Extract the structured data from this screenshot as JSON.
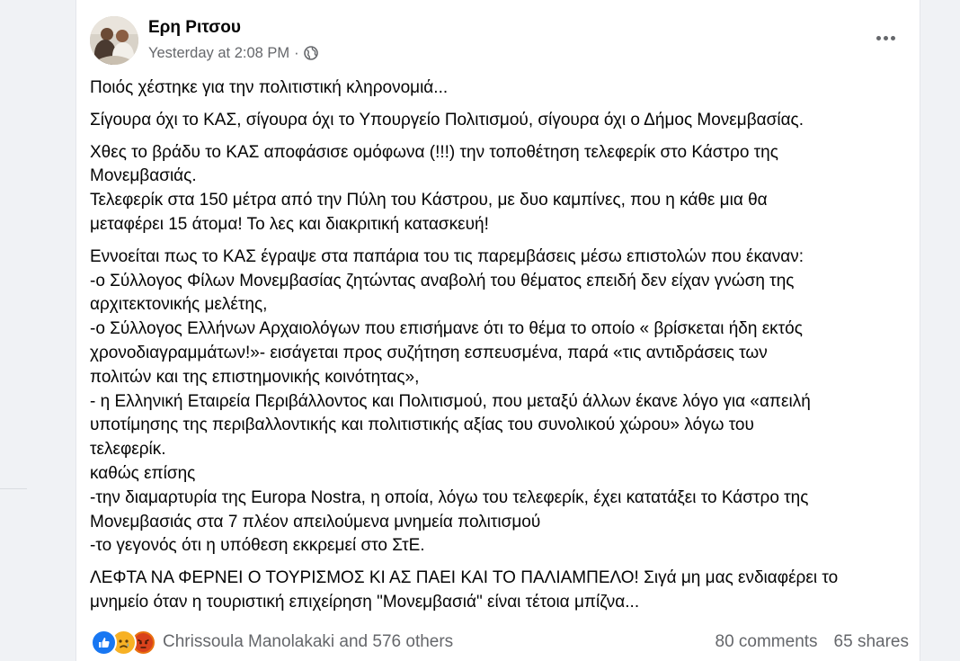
{
  "post": {
    "author": "Ερη Ριτσου",
    "timestamp": "Yesterday at 2:08 PM",
    "separator": "·",
    "privacy_icon": "globe-icon",
    "more_icon": "more-options-icon",
    "paragraphs": [
      [
        "Ποιός χέστηκε για την πολιτιστική κληρονομιά..."
      ],
      [
        "Σίγουρα όχι το ΚΑΣ, σίγουρα όχι το Υπουργείο Πολιτισμού, σίγουρα όχι ο Δήμος Μονεμβασίας."
      ],
      [
        "Χθες το βράδυ το ΚΑΣ αποφάσισε ομόφωνα (!!!) την τοποθέτηση τελεφερίκ στο Κάστρο της",
        "Μονεμβασιάς.",
        "Τελεφερίκ στα 150 μέτρα από την Πύλη του Κάστρου, με δυο καμπίνες, που η κάθε μια θα",
        "μεταφέρει 15 άτομα!  Το λες και διακριτική κατασκευή!"
      ],
      [
        "Εννοείται πως το ΚΑΣ έγραψε στα παπάρια του τις παρεμβάσεις μέσω επιστολών που έκαναν:",
        "-ο Σύλλογος Φίλων Μονεμβασίας ζητώντας αναβολή του θέματος επειδή δεν είχαν γνώση της",
        "αρχιτεκτονικής μελέτης,",
        "-ο Σύλλογος Ελλήνων Αρχαιολόγων που επισήμανε ότι το θέμα το οποίο « βρίσκεται ήδη εκτός",
        "χρονοδιαγραμμάτων!»- εισάγεται προς συζήτηση εσπευσμένα, παρά «τις αντιδράσεις των",
        "πολιτών και της επιστημονικής κοινότητας»,",
        "- η Ελληνική Εταιρεία Περιβάλλοντος και Πολιτισμού, που μεταξύ άλλων έκανε λόγο για «απειλή",
        "υποτίμησης της περιβαλλοντικής και πολιτιστικής αξίας του συνολικού χώρου» λόγω του",
        "τελεφερίκ.",
        "καθώς επίσης",
        "-την διαμαρτυρία της Europa Nostra, η οποία, λόγω του τελεφερίκ, έχει κατατάξει το Κάστρο της",
        "Μονεμβασιάς στα 7 πλέον απειλούμενα μνημεία πολιτισμού",
        "-το γεγονός ότι η υπόθεση εκκρεμεί στο ΣτΕ."
      ],
      [
        "ΛΕΦΤΑ ΝΑ ΦΕΡΝΕΙ Ο ΤΟΥΡΙΣΜΟΣ ΚΙ ΑΣ ΠΑΕΙ ΚΑΙ ΤΟ ΠΑΛΙΑΜΠΕΛΟ!  Σιγά μη μας ενδιαφέρει το",
        "μνημείο όταν η τουριστική επιχείρηση \"Μονεμβασιά\" είναι τέτοια μπίζνα..."
      ]
    ]
  },
  "engagement": {
    "reactions": [
      {
        "icon": "like-icon",
        "color": "#1877f2"
      },
      {
        "icon": "sad-icon",
        "color": "#f7b125"
      },
      {
        "icon": "angry-icon",
        "color": "#e9710f"
      }
    ],
    "reactors_text": "Chrissoula Manolakaki and 576 others",
    "comments": "80 comments",
    "shares": "65 shares"
  }
}
